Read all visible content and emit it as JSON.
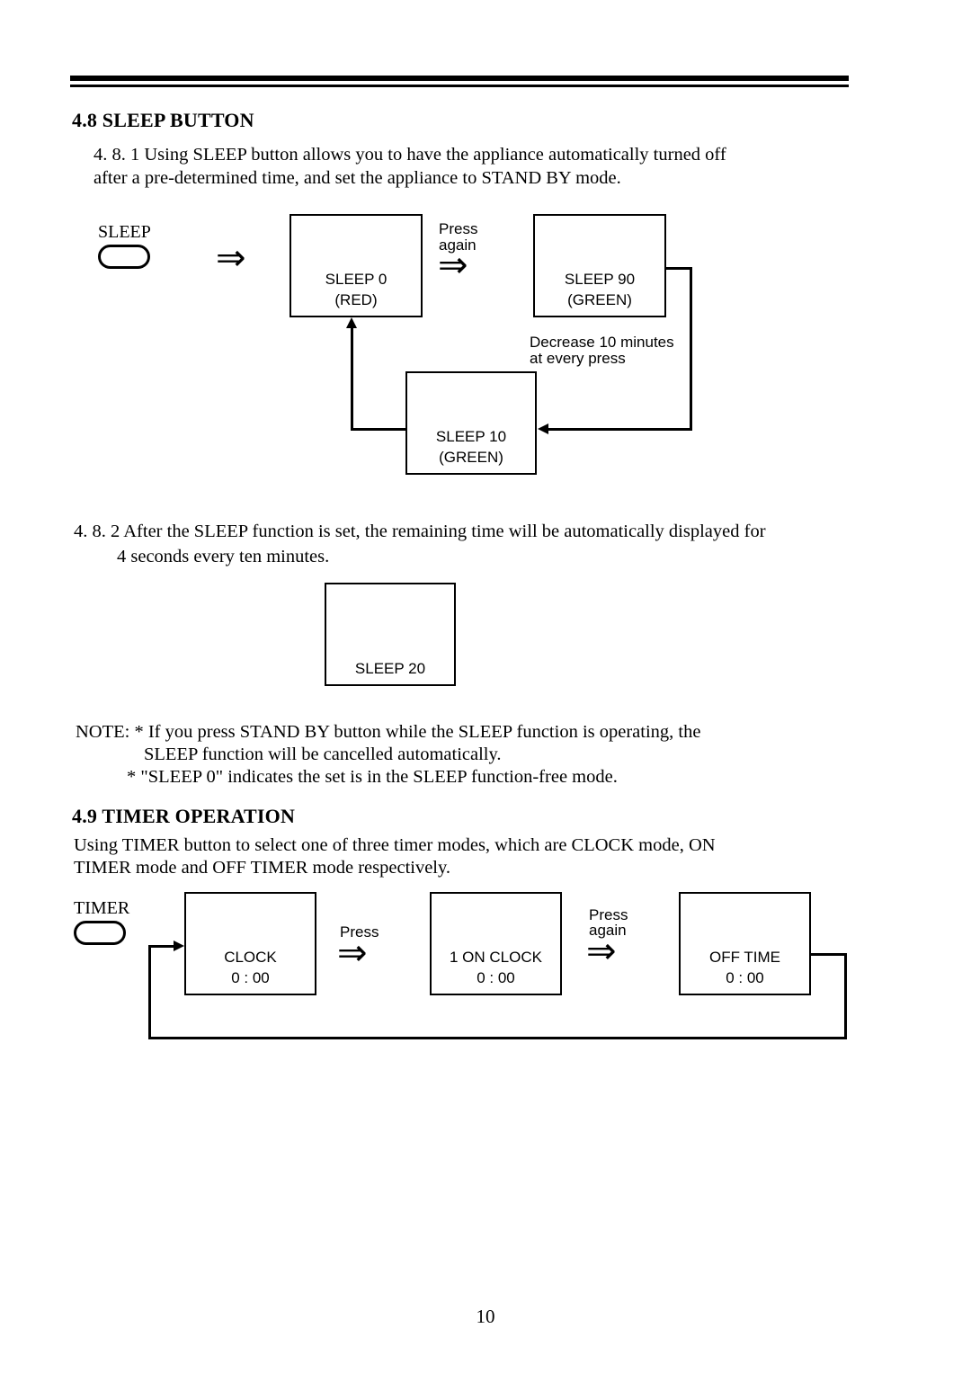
{
  "document": {
    "page_number": "10"
  },
  "section_48": {
    "heading": "4.8 SLEEP BUTTON",
    "para_1_line_1": "4. 8. 1 Using SLEEP button allows you to have the appliance automatically turned off",
    "para_1_line_2": "after a pre-determined time, and set the appliance to STAND BY mode.",
    "para_2_line_1": "4. 8. 2 After the SLEEP function is set, the remaining time will be automatically displayed for",
    "para_2_line_2": "4 seconds every ten minutes.",
    "note_line_1": "NOTE: * If you press STAND BY button while the SLEEP function is operating, the",
    "note_line_2": "SLEEP function will be cancelled automatically.",
    "note_line_3": "* \"SLEEP 0\" indicates the set is in the SLEEP function-free mode."
  },
  "sleep_diagram": {
    "button_label": "SLEEP",
    "arrow_glyph": "⇒",
    "press_again_line_1": "Press",
    "press_again_line_2": "again",
    "decrease_note_line_1": "Decrease 10 minutes",
    "decrease_note_line_2": "at every press",
    "states": [
      {
        "name": "SLEEP 0",
        "color": "(RED)"
      },
      {
        "name": "SLEEP 90",
        "color": "(GREEN)"
      },
      {
        "name": "SLEEP 10",
        "color": "(GREEN)"
      }
    ]
  },
  "sleep_display_example": {
    "label": "SLEEP 20"
  },
  "section_49": {
    "heading": "4.9 TIMER OPERATION",
    "para_line_1": "Using TIMER button to select one of three timer modes, which are CLOCK mode, ON",
    "para_line_2": "TIMER mode and OFF TIMER mode respectively."
  },
  "timer_diagram": {
    "button_label": "TIMER",
    "arrow_glyph": "⇒",
    "press_label": "Press",
    "press_again_line_1": "Press",
    "press_again_line_2": "again",
    "states": [
      {
        "name": "CLOCK",
        "time": "0 : 00"
      },
      {
        "name": "1 ON CLOCK",
        "time": "0 : 00"
      },
      {
        "name": "OFF TIME",
        "time": "0 : 00"
      }
    ]
  }
}
